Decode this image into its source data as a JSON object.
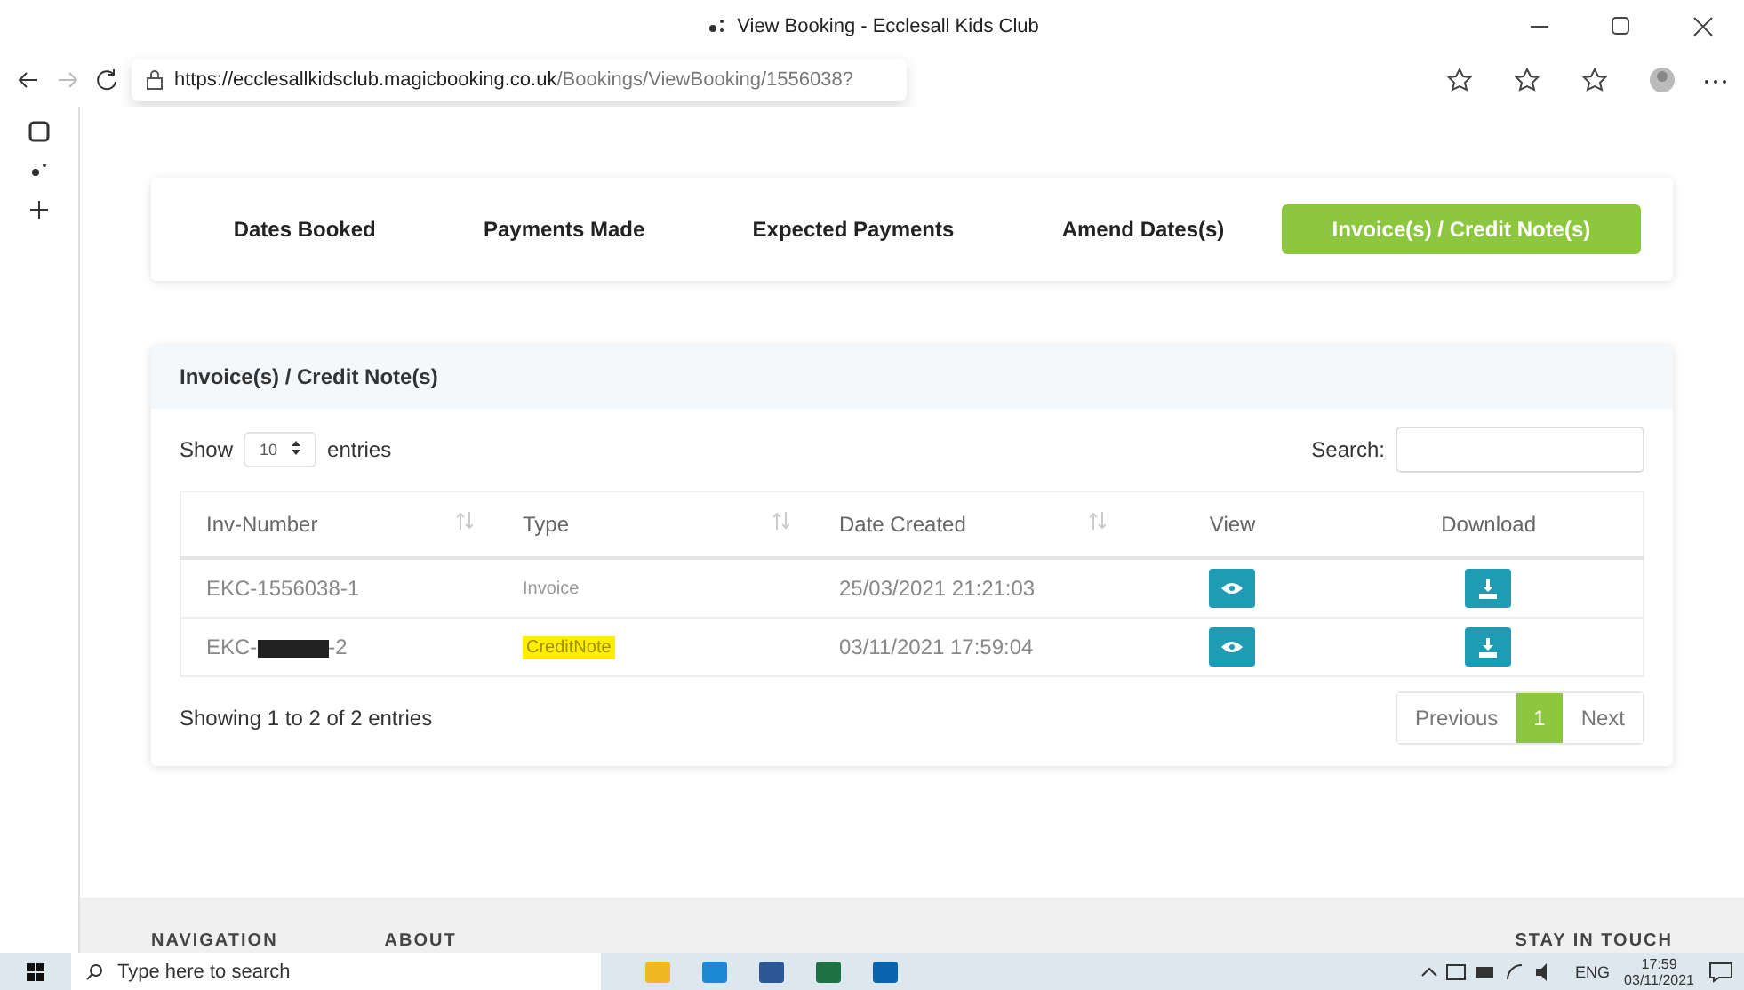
{
  "window": {
    "title": "View Booking - Ecclesall Kids Club"
  },
  "address_bar": {
    "host": "https://ecclesallkidsclub.magicbooking.co.uk",
    "path": "/Bookings/ViewBooking/1556038?"
  },
  "nav_tabs": [
    {
      "label": "Dates Booked",
      "selected": false
    },
    {
      "label": "Payments Made",
      "selected": false
    },
    {
      "label": "Expected Payments",
      "selected": false
    },
    {
      "label": "Amend Dates(s)",
      "selected": false
    },
    {
      "label": "Invoice(s) / Credit Note(s)",
      "selected": true
    }
  ],
  "panel": {
    "title": "Invoice(s) / Credit Note(s)",
    "show_label": "Show",
    "page_size": "10",
    "entries_label": "entries",
    "search_label": "Search:",
    "columns": [
      {
        "label": "Inv-Number",
        "sortable": true
      },
      {
        "label": "Type",
        "sortable": true
      },
      {
        "label": "Date Created",
        "sortable": true
      },
      {
        "label": "View",
        "sortable": false
      },
      {
        "label": "Download",
        "sortable": false
      }
    ],
    "rows": [
      {
        "inv_prefix": "EKC-1556038-1",
        "redacted": false,
        "inv_suffix": "",
        "type": "Invoice",
        "highlighted": false,
        "date": "25/03/2021 21:21:03"
      },
      {
        "inv_prefix": "EKC-",
        "redacted": true,
        "inv_suffix": "-2",
        "type": "CreditNote",
        "highlighted": true,
        "date": "03/11/2021 17:59:04"
      }
    ],
    "info": "Showing 1 to 2 of 2 entries",
    "pagination": [
      {
        "label": "Previous",
        "selected": false
      },
      {
        "label": "1",
        "selected": true
      },
      {
        "label": "Next",
        "selected": false
      }
    ]
  },
  "footer": {
    "headings": [
      "NAVIGATION",
      "ABOUT"
    ],
    "right_heading": "STAY IN TOUCH"
  },
  "taskbar": {
    "search_placeholder": "Type here to search",
    "language": "ENG",
    "time": "17:59",
    "date": "03/11/2021"
  }
}
